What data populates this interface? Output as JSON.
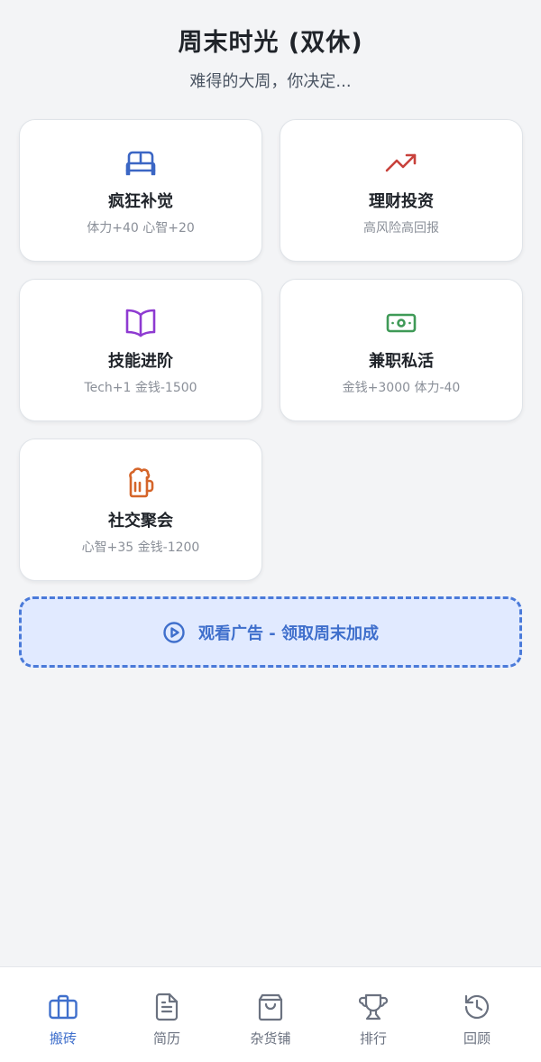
{
  "header": {
    "title": "周末时光 (双休)",
    "subtitle": "难得的大周，你决定..."
  },
  "options": [
    {
      "title": "疯狂补觉",
      "desc": "体力+40 心智+20",
      "icon": "bed-icon",
      "color": "#3b66c4"
    },
    {
      "title": "理财投资",
      "desc": "高风险高回报",
      "icon": "trending-up-icon",
      "color": "#c8413b"
    },
    {
      "title": "技能进阶",
      "desc": "Tech+1 金钱-1500",
      "icon": "book-open-icon",
      "color": "#8e3ad1"
    },
    {
      "title": "兼职私活",
      "desc": "金钱+3000 体力-40",
      "icon": "banknote-icon",
      "color": "#3f9a57"
    },
    {
      "title": "社交聚会",
      "desc": "心智+35 金钱-1200",
      "icon": "beer-mug-icon",
      "color": "#d5652a"
    }
  ],
  "ad": {
    "label": "观看广告 - 领取周末加成",
    "icon": "play-circle-icon",
    "color": "#3f6fcc"
  },
  "nav": {
    "items": [
      {
        "label": "搬砖",
        "icon": "briefcase-icon",
        "active": true
      },
      {
        "label": "简历",
        "icon": "document-icon",
        "active": false
      },
      {
        "label": "杂货铺",
        "icon": "shopping-bag-icon",
        "active": false
      },
      {
        "label": "排行",
        "icon": "trophy-icon",
        "active": false
      },
      {
        "label": "回顾",
        "icon": "history-icon",
        "active": false
      }
    ],
    "active_color": "#3f6fcc",
    "inactive_color": "#6b7280"
  }
}
